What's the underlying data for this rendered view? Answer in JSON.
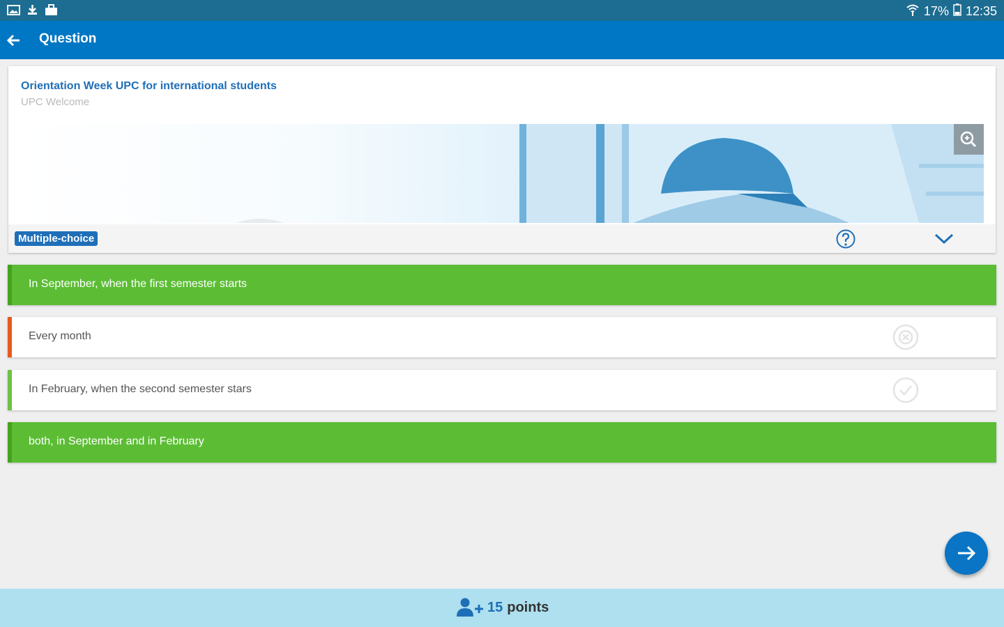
{
  "status": {
    "battery": "17%",
    "time": "12:35"
  },
  "app_bar": {
    "title": "Question"
  },
  "question": {
    "title": "Orientation Week UPC for international students",
    "subtitle": "UPC Welcome",
    "type_badge": "Multiple-choice"
  },
  "answers": [
    {
      "text": "In September, when the first semester starts",
      "state": "correct"
    },
    {
      "text": "Every month",
      "state": "wrong"
    },
    {
      "text": "In February, when the second semester stars",
      "state": "neutral"
    },
    {
      "text": "both, in September and in February",
      "state": "correct"
    }
  ],
  "footer": {
    "points_value": "15",
    "points_label": "points"
  },
  "colors": {
    "primary": "#0077c4",
    "status": "#1d6c91",
    "correct": "#5cbd35",
    "wrong": "#e75b1f",
    "footer": "#aee0ef"
  },
  "icons": [
    "gallery-icon",
    "download-icon",
    "bag-icon",
    "wifi-icon",
    "battery-icon",
    "back-arrow-icon",
    "zoom-icon",
    "help-icon",
    "chevron-down-icon",
    "wrong-mark-icon",
    "check-mark-icon",
    "next-arrow-icon",
    "add-user-icon"
  ]
}
